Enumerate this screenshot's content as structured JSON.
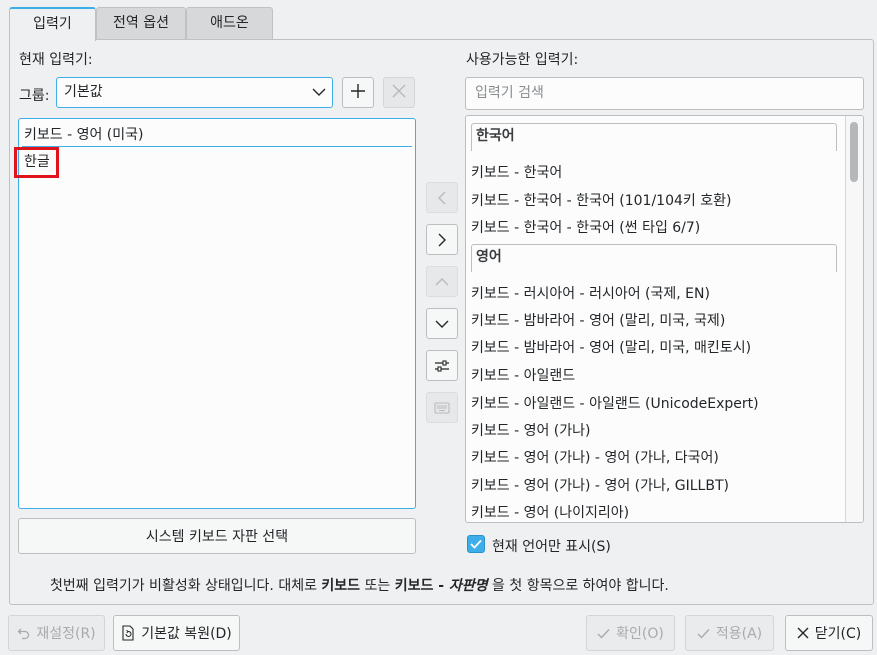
{
  "tabs": [
    {
      "label": "입력기",
      "active": true
    },
    {
      "label": "전역 옵션",
      "active": false
    },
    {
      "label": "애드온",
      "active": false
    }
  ],
  "current": {
    "title": "현재 입력기:",
    "group_label": "그룹:",
    "group_value": "기본값",
    "items": [
      "키보드 - 영어 (미국)",
      "한글"
    ],
    "system_layout_button": "시스템 키보드 자판 선택"
  },
  "available": {
    "title": "사용가능한 입력기:",
    "search_placeholder": "입력기 검색",
    "groups": [
      {
        "name": "한국어",
        "items": [
          "키보드 - 한국어",
          "키보드 - 한국어 - 한국어 (101/104키 호환)",
          "키보드 - 한국어 - 한국어 (썬 타입 6/7)"
        ]
      },
      {
        "name": "영어",
        "items": [
          "키보드 - 러시아어 - 러시아어 (국제, EN)",
          "키보드 - 밤바라어 - 영어 (말리, 미국, 국제)",
          "키보드 - 밤바라어 - 영어 (말리, 미국, 매킨토시)",
          "키보드 - 아일랜드",
          "키보드 - 아일랜드 - 아일랜드 (UnicodeExpert)",
          "키보드 - 영어 (가나)",
          "키보드 - 영어 (가나) - 영어 (가나, 다국어)",
          "키보드 - 영어 (가나) - 영어 (가나, GILLBT)",
          "키보드 - 영어 (나이지리아)"
        ]
      }
    ],
    "only_current_language": "현재 언어만 표시(S)"
  },
  "warning": {
    "part1": "첫번째 입력기가 비활성화 상태입니다. 대체로 ",
    "bold1": "키보드",
    "part2": " 또는 ",
    "bold2": "키보드 - ",
    "bold2_italic": "자판명",
    "part3": " 을 첫 항목으로 하여야 합니다."
  },
  "footer": {
    "reset": "재설정(R)",
    "defaults": "기본값 복원(D)",
    "ok": "확인(O)",
    "apply": "적용(A)",
    "close": "닫기(C)"
  },
  "colors": {
    "accent": "#3daee9",
    "highlight_box": "#e0141c"
  }
}
